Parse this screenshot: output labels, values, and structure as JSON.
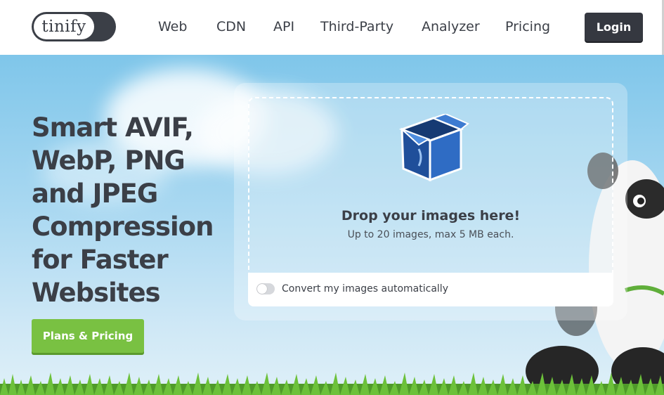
{
  "header": {
    "logo_text": "tinify",
    "nav": [
      {
        "label": "Web",
        "name": "nav-web"
      },
      {
        "label": "CDN",
        "name": "nav-cdn"
      },
      {
        "label": "API",
        "name": "nav-api"
      },
      {
        "label": "Third-Party",
        "name": "nav-third-party"
      },
      {
        "label": "Analyzer",
        "name": "nav-analyzer"
      },
      {
        "label": "Pricing",
        "name": "nav-pricing"
      }
    ],
    "login_label": "Login"
  },
  "hero": {
    "headline_lines": [
      "Smart AVIF,",
      "WebP, PNG",
      "and JPEG",
      "Compression",
      "for Faster",
      "Websites"
    ],
    "cta_label": "Plans & Pricing"
  },
  "uploader": {
    "icon": "box-icon",
    "title": "Drop your images here!",
    "subtitle": "Up to 20 images, max 5 MB each.",
    "convert_label": "Convert my images automatically",
    "convert_enabled": false
  },
  "colors": {
    "dark": "#3b3f47",
    "accent_green": "#79c142",
    "sky": "#a9d8f1",
    "box_blue": "#2f6cc4"
  }
}
